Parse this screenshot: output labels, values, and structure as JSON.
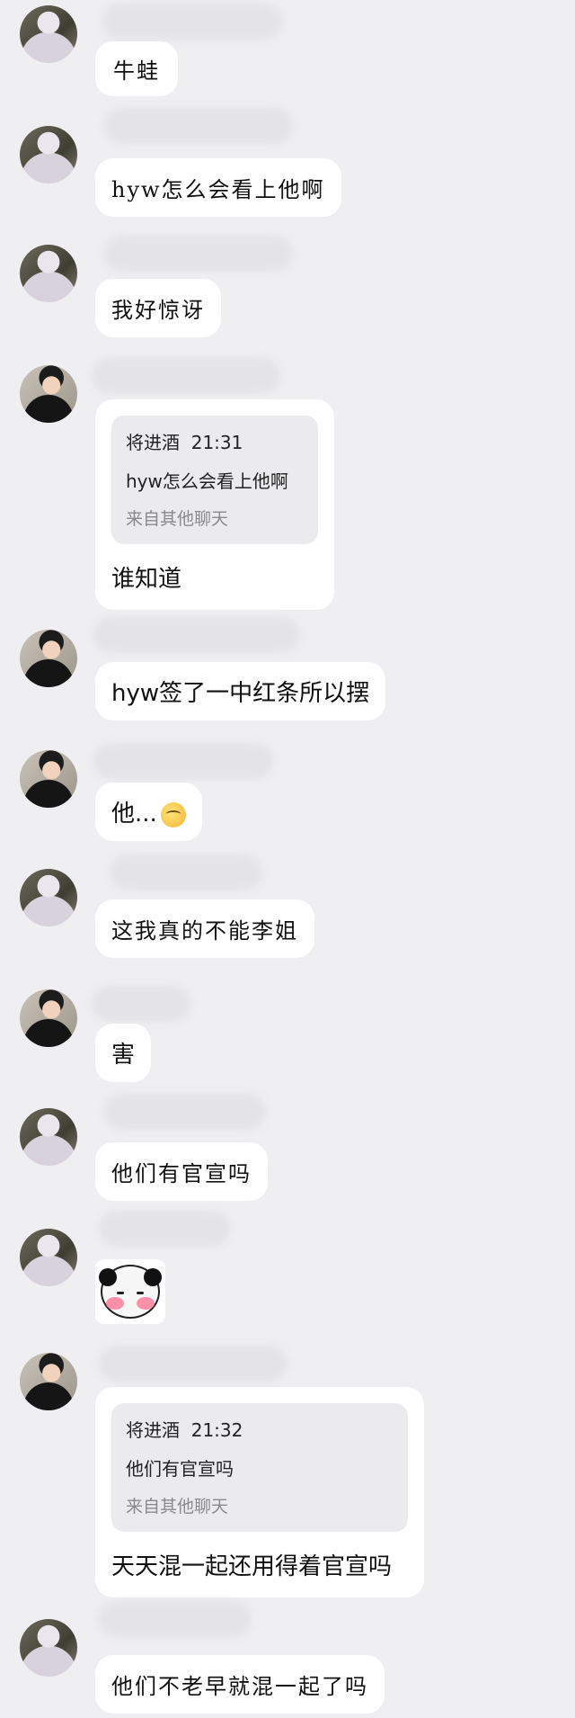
{
  "messages": [
    {
      "sender": "a",
      "text": "牛蛙"
    },
    {
      "sender": "a",
      "text": "hyw怎么会看上他啊"
    },
    {
      "sender": "a",
      "text": "我好惊讶"
    },
    {
      "sender": "b",
      "quote": {
        "author": "将进酒",
        "time": "21:31",
        "text": "hyw怎么会看上他啊",
        "source": "来自其他聊天"
      },
      "text": "谁知道"
    },
    {
      "sender": "b",
      "text": "hyw签了一中红条所以摆"
    },
    {
      "sender": "b",
      "text": "他...",
      "emoji": "squinting-face-emoji"
    },
    {
      "sender": "a",
      "text": "这我真的不能李姐"
    },
    {
      "sender": "b",
      "text": "害"
    },
    {
      "sender": "a",
      "text": "他们有官宣吗"
    },
    {
      "sender": "a",
      "sticker": "blushing-panda-sticker"
    },
    {
      "sender": "b",
      "quote": {
        "author": "将进酒",
        "time": "21:32",
        "text": "他们有官宣吗",
        "source": "来自其他聊天"
      },
      "text": "天天混一起还用得着官宣吗"
    },
    {
      "sender": "a",
      "text": "他们不老早就混一起了吗"
    }
  ]
}
